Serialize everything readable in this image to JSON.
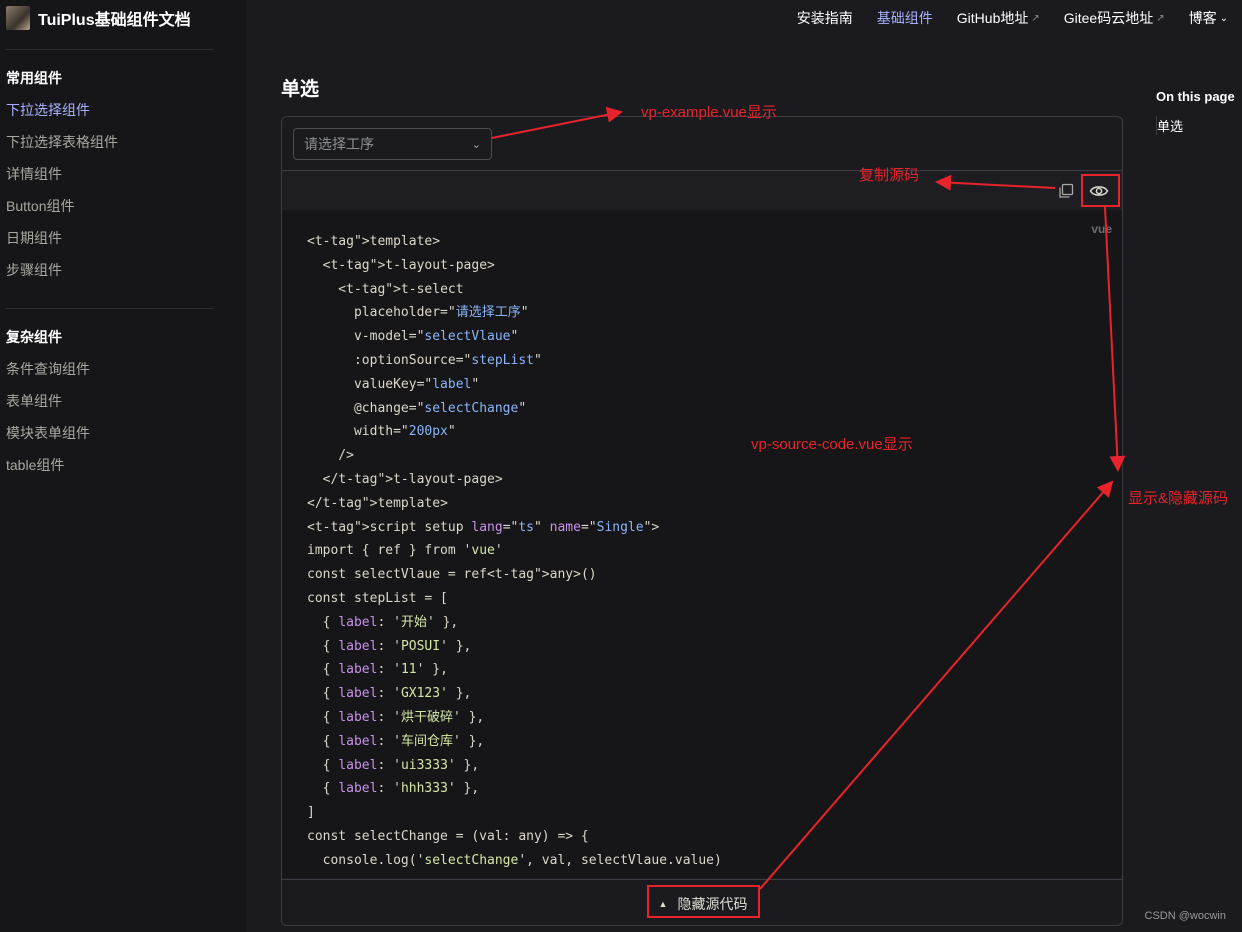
{
  "brand": {
    "title": "TuiPlus基础组件文档"
  },
  "sidebar": {
    "groups": [
      {
        "title": "常用组件",
        "items": [
          "下拉选择组件",
          "下拉选择表格组件",
          "详情组件",
          "Button组件",
          "日期组件",
          "步骤组件"
        ]
      },
      {
        "title": "复杂组件",
        "items": [
          "条件查询组件",
          "表单组件",
          "模块表单组件",
          "table组件"
        ]
      }
    ]
  },
  "topnav": {
    "items": [
      {
        "label": "安装指南"
      },
      {
        "label": "基础组件"
      },
      {
        "label": "GitHub地址",
        "ext": "↗"
      },
      {
        "label": "Gitee码云地址",
        "ext": "↗"
      },
      {
        "label": "博客",
        "chevron": "⌄"
      }
    ]
  },
  "main": {
    "title": "单选",
    "select_placeholder": "请选择工序",
    "lang_label": "vue",
    "toggle_label": "隐藏源代码"
  },
  "outline": {
    "title": "On this page",
    "items": [
      "单选"
    ]
  },
  "code": {
    "lines": [
      "<template>",
      "  <t-layout-page>",
      "    <t-select",
      "      placeholder=\"请选择工序\"",
      "      v-model=\"selectVlaue\"",
      "      :optionSource=\"stepList\"",
      "      valueKey=\"label\"",
      "      @change=\"selectChange\"",
      "      width=\"200px\"",
      "    />",
      "  </t-layout-page>",
      "</template>",
      "<script setup lang=\"ts\" name=\"Single\">",
      "import { ref } from 'vue'",
      "const selectVlaue = ref<any>()",
      "const stepList = [",
      "  { label: '开始' },",
      "  { label: 'POSUI' },",
      "  { label: '11' },",
      "  { label: 'GX123' },",
      "  { label: '烘干破碎' },",
      "  { label: '车间仓库' },",
      "  { label: 'ui3333' },",
      "  { label: 'hhh333' },",
      "]",
      "const selectChange = (val: any) => {",
      "  console.log('selectChange', val, selectVlaue.value)"
    ]
  },
  "annotations": {
    "example": "vp-example.vue显示",
    "copy": "复制源码",
    "source": "vp-source-code.vue显示",
    "toggle": "显示&隐藏源码"
  },
  "watermark": "CSDN @wocwin",
  "colors": {
    "accent": "#a8b1ff",
    "annotation": "#e8232b"
  }
}
